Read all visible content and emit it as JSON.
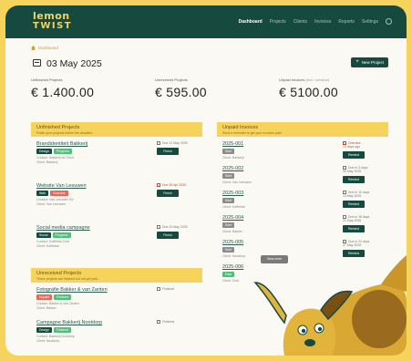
{
  "brand": {
    "line1": "lemon",
    "line2": "TWIST",
    "color": "#f2d36a"
  },
  "nav": {
    "items": [
      "Dashboard",
      "Projects",
      "Clients",
      "Invoices",
      "Reports",
      "Settings"
    ],
    "active": "Dashboard"
  },
  "breadcrumb": "Dashboard",
  "date": "03 May 2025",
  "new_project_label": "New Project",
  "stats": [
    {
      "label": "Unfinished Projects",
      "label_suffix": "",
      "value": "€ 1.400.00"
    },
    {
      "label": "Unreceived Projects",
      "label_suffix": "",
      "value": "€ 595.00"
    },
    {
      "label": "Unpaid Invoices",
      "label_suffix": "(Incl. overdue)",
      "value": "€ 5100.00"
    }
  ],
  "unfinished": {
    "title": "Unfinished Projects",
    "subtitle": "Finish your projects before the deadline.",
    "items": [
      {
        "title": "Brandidentiteit Bakkerij",
        "tags": [
          {
            "text": "Design",
            "style": "dark"
          },
          {
            "text": "Progress",
            "style": "green"
          }
        ],
        "meta1": "Contact: Bakkerij de Groot",
        "meta2": "Client: Bakkerij",
        "due": "Due 12 May 2025",
        "button": "Finish"
      },
      {
        "title": "Website Van Leeuwen",
        "tags": [
          {
            "text": "Web",
            "style": "dark"
          },
          {
            "text": "Overdue",
            "style": "red"
          }
        ],
        "meta1": "Contact: Van Leeuwen BV",
        "meta2": "Client: Van Leeuwen",
        "due": "Due 28 Apr 2025",
        "button": "Finish"
      },
      {
        "title": "Social media campagne",
        "tags": [
          {
            "text": "Social",
            "style": "dark"
          },
          {
            "text": "Progress",
            "style": "green"
          }
        ],
        "meta1": "Contact: Koffiebar Zuid",
        "meta2": "Client: Koffiebar",
        "due": "Due 20 May 2025",
        "button": "Finish"
      }
    ]
  },
  "unreceived": {
    "title": "Unreceived Projects",
    "subtitle": "These projects are finished but not yet paid.",
    "items": [
      {
        "title": "Fotografie Bakker & van Zanten",
        "tags": [
          {
            "text": "Unpaid",
            "style": "red"
          },
          {
            "text": "Finished",
            "style": "green"
          }
        ],
        "meta1": "Contact: Bakker & van Zanten",
        "meta2": "Client: Bakker",
        "due": "Finished"
      },
      {
        "title": "Campagne Bakkerij Nootdorp",
        "tags": [
          {
            "text": "Design",
            "style": "dark"
          },
          {
            "text": "Finished",
            "style": "green"
          }
        ],
        "meta1": "Contact: Bakkerij Nootdorp",
        "meta2": "Client: Nootdorp",
        "due": "Finished"
      }
    ]
  },
  "unpaid": {
    "title": "Unpaid Invoices",
    "subtitle": "Send a reminder to get your invoices paid.",
    "items": [
      {
        "title": "2025-001",
        "tag": "Sent",
        "tag_style": "grey",
        "meta": "Client: Bakkerij",
        "due": "Overdue",
        "due_style": "red",
        "sub": "14 days ago",
        "button": "Remind"
      },
      {
        "title": "2025-002",
        "tag": "Sent",
        "tag_style": "grey",
        "meta": "Client: Van Leeuwen",
        "due": "Due in 3 days",
        "due_style": "",
        "sub": "06 May 2025",
        "button": "Remind"
      },
      {
        "title": "2025-003",
        "tag": "Sent",
        "tag_style": "grey",
        "meta": "Client: Koffiebar",
        "due": "Due in 10 days",
        "due_style": "",
        "sub": "13 May 2025",
        "button": "Remind"
      },
      {
        "title": "2025-004",
        "tag": "Sent",
        "tag_style": "grey",
        "meta": "Client: Bakker",
        "due": "Due in 18 days",
        "due_style": "",
        "sub": "21 May 2025",
        "button": "Remind"
      },
      {
        "title": "2025-005",
        "tag": "Sent",
        "tag_style": "grey",
        "meta": "Client: Nootdorp",
        "due": "Due in 24 days",
        "due_style": "",
        "sub": "27 May 2025",
        "button": "Remind"
      },
      {
        "title": "2025-006",
        "tag": "Paid",
        "tag_style": "green",
        "meta": "Client: Zuid",
        "due": "",
        "due_style": "",
        "sub": "",
        "button": ""
      }
    ]
  },
  "view_more": "View more",
  "colors": {
    "primary": "#174a3f",
    "accent": "#f6d35c",
    "danger": "#e36b5b",
    "success": "#4fbf7a"
  }
}
